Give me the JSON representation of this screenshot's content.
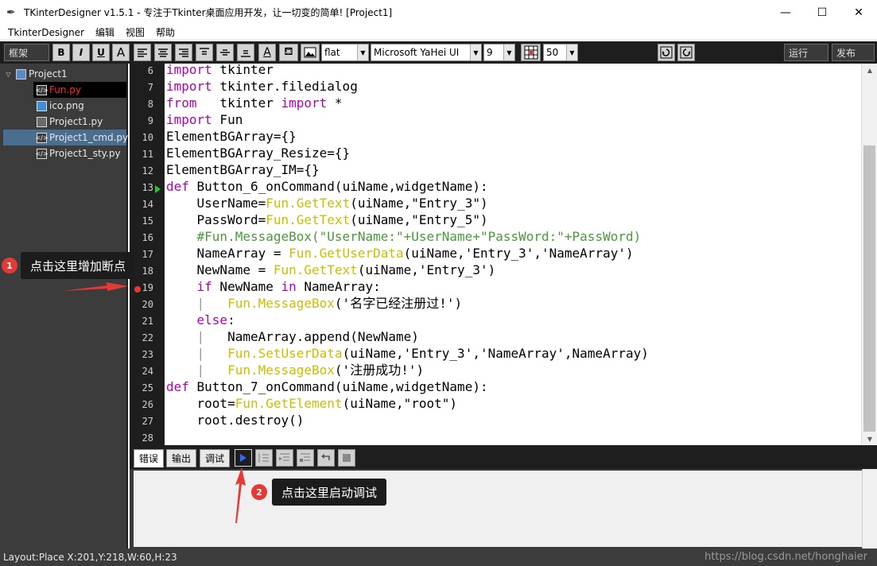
{
  "window": {
    "title": "TKinterDesigner v1.5.1 - 专注于Tkinter桌面应用开发，让一切变的简单!    [Project1]",
    "minimize": "—",
    "maximize": "☐",
    "close": "✕"
  },
  "menu": [
    "TkinterDesigner",
    "编辑",
    "视图",
    "帮助"
  ],
  "toolbar": {
    "frame_label": "框架",
    "bold": "B",
    "italic": "I",
    "underline": "U",
    "font_color": "A",
    "relief": "flat",
    "font_family": "Microsoft YaHei UI",
    "font_size": "9",
    "grid_size": "50",
    "run": "运行",
    "publish": "发布"
  },
  "tree": {
    "root": "Project1",
    "files": [
      {
        "name": "Fun.py",
        "type": "code",
        "state": "selected-red"
      },
      {
        "name": "ico.png",
        "type": "image",
        "state": "normal"
      },
      {
        "name": "Project1.py",
        "type": "window",
        "state": "normal"
      },
      {
        "name": "Project1_cmd.py",
        "type": "code",
        "state": "selected-blue"
      },
      {
        "name": "Project1_sty.py",
        "type": "code",
        "state": "normal"
      }
    ]
  },
  "editor": {
    "line_numbers": [
      "6",
      "7",
      "8",
      "9",
      "10",
      "11",
      "12",
      "13",
      "14",
      "15",
      "16",
      "17",
      "18",
      "19",
      "20",
      "21",
      "22",
      "23",
      "24",
      "25",
      "26",
      "27",
      "28"
    ],
    "breakpoint_line": "19",
    "current_line": "13",
    "lines": [
      [
        {
          "t": "import",
          "c": "kw"
        },
        {
          "t": " tkinter",
          "c": ""
        }
      ],
      [
        {
          "t": "import",
          "c": "kw"
        },
        {
          "t": " tkinter.filedialog",
          "c": ""
        }
      ],
      [
        {
          "t": "from",
          "c": "kw"
        },
        {
          "t": "   tkinter ",
          "c": ""
        },
        {
          "t": "import",
          "c": "kw"
        },
        {
          "t": " *",
          "c": ""
        }
      ],
      [
        {
          "t": "import",
          "c": "kw"
        },
        {
          "t": " Fun",
          "c": ""
        }
      ],
      [
        {
          "t": "ElementBGArray={}",
          "c": ""
        }
      ],
      [
        {
          "t": "ElementBGArray_Resize={}",
          "c": ""
        }
      ],
      [
        {
          "t": "ElementBGArray_IM={}",
          "c": ""
        }
      ],
      [
        {
          "t": "def",
          "c": "kw"
        },
        {
          "t": " Button_6_onCommand(uiName,widgetName):",
          "c": ""
        }
      ],
      [
        {
          "t": "    UserName=",
          "c": ""
        },
        {
          "t": "Fun.GetText",
          "c": "fn"
        },
        {
          "t": "(uiName,\"Entry_3\")",
          "c": ""
        }
      ],
      [
        {
          "t": "    PassWord=",
          "c": ""
        },
        {
          "t": "Fun.GetText",
          "c": "fn"
        },
        {
          "t": "(uiName,\"Entry_5\")",
          "c": ""
        }
      ],
      [
        {
          "t": "    #Fun.MessageBox(\"UserName:\"+UserName+\"PassWord:\"+PassWord)",
          "c": "cm"
        }
      ],
      [
        {
          "t": "    NameArray = ",
          "c": ""
        },
        {
          "t": "Fun.GetUserData",
          "c": "fn"
        },
        {
          "t": "(uiName,'Entry_3','NameArray')",
          "c": ""
        }
      ],
      [
        {
          "t": "    NewName = ",
          "c": ""
        },
        {
          "t": "Fun.GetText",
          "c": "fn"
        },
        {
          "t": "(uiName,'Entry_3')",
          "c": ""
        }
      ],
      [
        {
          "t": "    ",
          "c": ""
        },
        {
          "t": "if",
          "c": "kw"
        },
        {
          "t": " NewName ",
          "c": ""
        },
        {
          "t": "in",
          "c": "kw"
        },
        {
          "t": " NameArray:",
          "c": ""
        }
      ],
      [
        {
          "t": "    |   ",
          "c": "pipe"
        },
        {
          "t": "Fun.MessageBox",
          "c": "fn"
        },
        {
          "t": "('名字已经注册过!')",
          "c": ""
        }
      ],
      [
        {
          "t": "    ",
          "c": ""
        },
        {
          "t": "else",
          "c": "kw"
        },
        {
          "t": ":",
          "c": ""
        }
      ],
      [
        {
          "t": "    |   ",
          "c": "pipe"
        },
        {
          "t": "NameArray.append(NewName)",
          "c": ""
        }
      ],
      [
        {
          "t": "    |   ",
          "c": "pipe"
        },
        {
          "t": "Fun.SetUserData",
          "c": "fn"
        },
        {
          "t": "(uiName,'Entry_3','NameArray',NameArray)",
          "c": ""
        }
      ],
      [
        {
          "t": "    |   ",
          "c": "pipe"
        },
        {
          "t": "Fun.MessageBox",
          "c": "fn"
        },
        {
          "t": "('注册成功!')",
          "c": ""
        }
      ],
      [
        {
          "t": "def",
          "c": "kw"
        },
        {
          "t": " Button_7_onCommand(uiName,widgetName):",
          "c": ""
        }
      ],
      [
        {
          "t": "    root=",
          "c": ""
        },
        {
          "t": "Fun.GetElement",
          "c": "fn"
        },
        {
          "t": "(uiName,\"root\")",
          "c": ""
        }
      ],
      [
        {
          "t": "    root.destroy()",
          "c": ""
        }
      ],
      [
        {
          "t": "",
          "c": ""
        }
      ]
    ]
  },
  "bottom_tabs": [
    "错误",
    "输出",
    "调试"
  ],
  "status": "Layout:Place  X:201,Y:218,W:60,H:23",
  "watermark": "https://blog.csdn.net/honghaier",
  "annotations": {
    "one_badge": "1",
    "one_text": "点击这里增加断点",
    "two_badge": "2",
    "two_text": "点击这里启动调试"
  },
  "colors": {
    "keyword": "#b000b0",
    "function": "#c8c000",
    "comment": "#4a9a3a",
    "breakpoint": "#e53935",
    "arrow": "#e53935"
  }
}
